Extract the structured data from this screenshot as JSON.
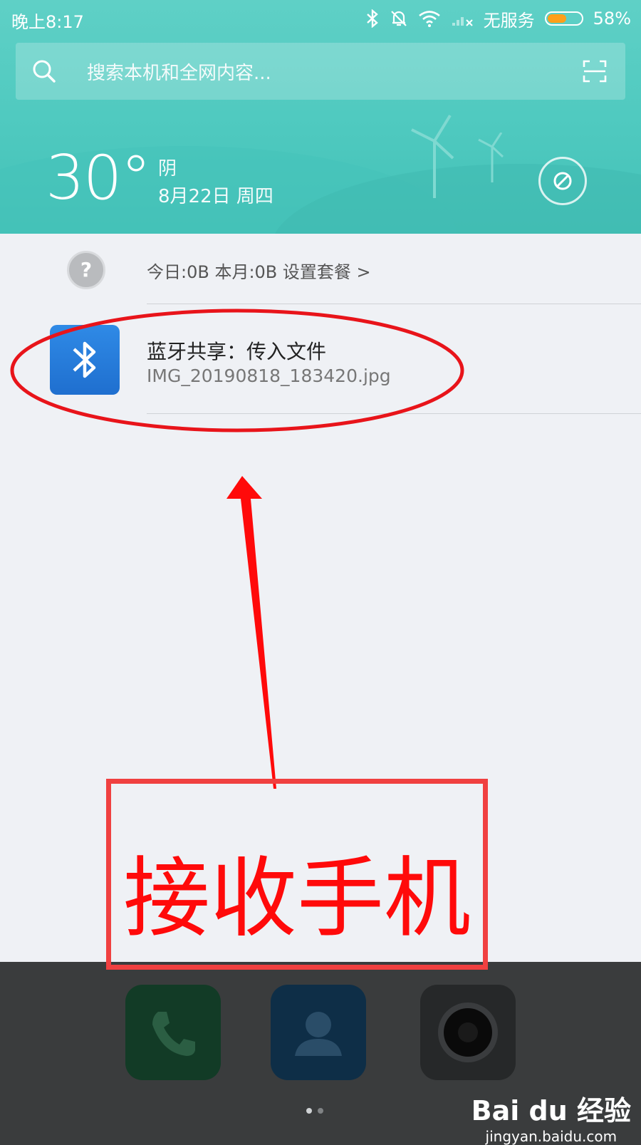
{
  "status_bar": {
    "time": "晚上8:17",
    "carrier": "无服务",
    "battery_percent": "58%",
    "battery_level": 0.58
  },
  "search": {
    "placeholder": "搜索本机和全网内容..."
  },
  "weather": {
    "temperature": "30°",
    "condition": "阴",
    "date": "8月22日 周四"
  },
  "data_usage": {
    "text": "今日:0B   本月:0B   设置套餐 >"
  },
  "notification": {
    "title": "蓝牙共享：传入文件",
    "file": "IMG_20190818_183420.jpg"
  },
  "annotation": {
    "label": "接收手机",
    "color": "#ff0a0a"
  },
  "dock": {
    "apps": [
      "phone-icon",
      "contacts-icon",
      "camera-icon"
    ],
    "page_dots": 2,
    "current_page": 1
  },
  "watermark": {
    "brand": "Bai du 经验",
    "url": "jingyan.baidu.com"
  },
  "colors": {
    "teal": "#4ec9bf",
    "panel": "#eff1f5",
    "bt_blue": "#2f8ae6",
    "battery": "#ff9f1a"
  }
}
